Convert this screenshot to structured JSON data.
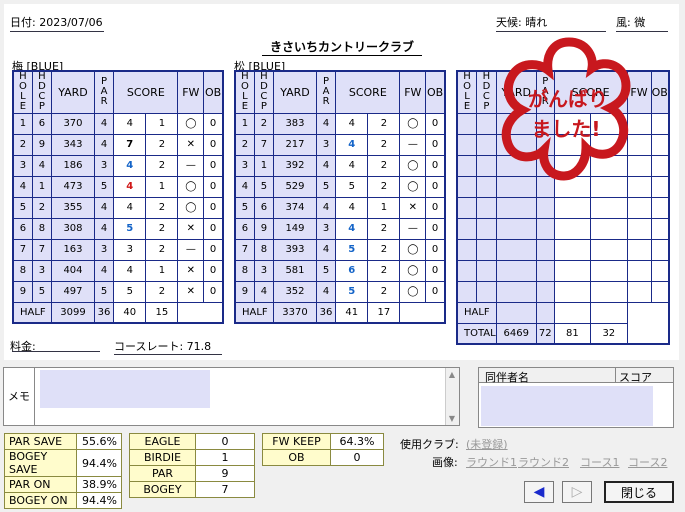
{
  "header": {
    "date_label": "日付: 2023/07/06",
    "course_name": "きさいちカントリークラブ",
    "weather": "天候: 晴れ",
    "wind": "風: 微"
  },
  "columns": {
    "hole": "HOLE",
    "hdcp": "HDCP",
    "yard": "YARD",
    "par": "PAR",
    "score": "SCORE",
    "fw": "FW",
    "ob": "OB"
  },
  "tee1": "梅 [BLUE]",
  "tee2": "松 [BLUE]",
  "front9": [
    {
      "hole": "1",
      "hdcp": "6",
      "yard": "370",
      "par": "4",
      "score": "4",
      "putts": "1",
      "fw": "◯",
      "ob": "0",
      "cls": ""
    },
    {
      "hole": "2",
      "hdcp": "9",
      "yard": "343",
      "par": "4",
      "score": "7",
      "putts": "2",
      "fw": "✕",
      "ob": "0",
      "cls": "k"
    },
    {
      "hole": "3",
      "hdcp": "4",
      "yard": "186",
      "par": "3",
      "score": "4",
      "putts": "2",
      "fw": "—",
      "ob": "0",
      "cls": "b"
    },
    {
      "hole": "4",
      "hdcp": "1",
      "yard": "473",
      "par": "5",
      "score": "4",
      "putts": "1",
      "fw": "◯",
      "ob": "0",
      "cls": "r"
    },
    {
      "hole": "5",
      "hdcp": "2",
      "yard": "355",
      "par": "4",
      "score": "4",
      "putts": "2",
      "fw": "◯",
      "ob": "0",
      "cls": ""
    },
    {
      "hole": "6",
      "hdcp": "8",
      "yard": "308",
      "par": "4",
      "score": "5",
      "putts": "2",
      "fw": "✕",
      "ob": "0",
      "cls": "b"
    },
    {
      "hole": "7",
      "hdcp": "7",
      "yard": "163",
      "par": "3",
      "score": "3",
      "putts": "2",
      "fw": "—",
      "ob": "0",
      "cls": ""
    },
    {
      "hole": "8",
      "hdcp": "3",
      "yard": "404",
      "par": "4",
      "score": "4",
      "putts": "1",
      "fw": "✕",
      "ob": "0",
      "cls": ""
    },
    {
      "hole": "9",
      "hdcp": "5",
      "yard": "497",
      "par": "5",
      "score": "5",
      "putts": "2",
      "fw": "✕",
      "ob": "0",
      "cls": ""
    }
  ],
  "front_half": {
    "label": "HALF",
    "yard": "3099",
    "par": "36",
    "score": "40",
    "putts": "15"
  },
  "back9": [
    {
      "hole": "1",
      "hdcp": "2",
      "yard": "383",
      "par": "4",
      "score": "4",
      "putts": "2",
      "fw": "◯",
      "ob": "0",
      "cls": ""
    },
    {
      "hole": "2",
      "hdcp": "7",
      "yard": "217",
      "par": "3",
      "score": "4",
      "putts": "2",
      "fw": "—",
      "ob": "0",
      "cls": "b"
    },
    {
      "hole": "3",
      "hdcp": "1",
      "yard": "392",
      "par": "4",
      "score": "4",
      "putts": "2",
      "fw": "◯",
      "ob": "0",
      "cls": ""
    },
    {
      "hole": "4",
      "hdcp": "5",
      "yard": "529",
      "par": "5",
      "score": "5",
      "putts": "2",
      "fw": "◯",
      "ob": "0",
      "cls": ""
    },
    {
      "hole": "5",
      "hdcp": "6",
      "yard": "374",
      "par": "4",
      "score": "4",
      "putts": "1",
      "fw": "✕",
      "ob": "0",
      "cls": ""
    },
    {
      "hole": "6",
      "hdcp": "9",
      "yard": "149",
      "par": "3",
      "score": "4",
      "putts": "2",
      "fw": "—",
      "ob": "0",
      "cls": "b"
    },
    {
      "hole": "7",
      "hdcp": "8",
      "yard": "393",
      "par": "4",
      "score": "5",
      "putts": "2",
      "fw": "◯",
      "ob": "0",
      "cls": "b"
    },
    {
      "hole": "8",
      "hdcp": "3",
      "yard": "581",
      "par": "5",
      "score": "6",
      "putts": "2",
      "fw": "◯",
      "ob": "0",
      "cls": "b"
    },
    {
      "hole": "9",
      "hdcp": "4",
      "yard": "352",
      "par": "4",
      "score": "5",
      "putts": "2",
      "fw": "◯",
      "ob": "0",
      "cls": "b"
    }
  ],
  "back_half": {
    "label": "HALF",
    "yard": "3370",
    "par": "36",
    "score": "41",
    "putts": "17"
  },
  "third": {
    "half": "HALF",
    "total": "TOTAL",
    "total_yard": "6469",
    "total_par": "72",
    "total_score": "81",
    "total_putts": "32"
  },
  "stamp": {
    "line1": "がんばり",
    "line2": "ました!",
    "color": "#c8181e"
  },
  "fee_label": "料金:",
  "course_rate": "コースレート: 71.8",
  "memo_label": "メモ",
  "companions": {
    "name_header": "同伴者名",
    "score_header": "スコア"
  },
  "stats_a": [
    {
      "label": "PAR SAVE",
      "value": "55.6%"
    },
    {
      "label": "BOGEY SAVE",
      "value": "94.4%"
    },
    {
      "label": "PAR ON",
      "value": "38.9%"
    },
    {
      "label": "BOGEY ON",
      "value": "94.4%"
    }
  ],
  "stats_b": [
    {
      "label": "EAGLE",
      "value": "0"
    },
    {
      "label": "BIRDIE",
      "value": "1"
    },
    {
      "label": "PAR",
      "value": "9"
    },
    {
      "label": "BOGEY",
      "value": "7"
    }
  ],
  "stats_c": [
    {
      "label": "FW KEEP",
      "value": "64.3%"
    },
    {
      "label": "OB",
      "value": "0"
    }
  ],
  "clubs": {
    "label": "使用クラブ:",
    "value": "(未登録)"
  },
  "images": {
    "label": "画像:",
    "links": [
      "ラウンド1",
      "ラウンド2",
      "コース1",
      "コース2"
    ]
  },
  "buttons": {
    "close": "閉じる",
    "prev": "◀",
    "next": "▷"
  },
  "colors": {
    "table_border": "#1a2a88",
    "row_blue": "#dfe0f8",
    "score_blue": "#1464c8",
    "score_red": "#d01818",
    "stat_bg": "#fffccc"
  }
}
